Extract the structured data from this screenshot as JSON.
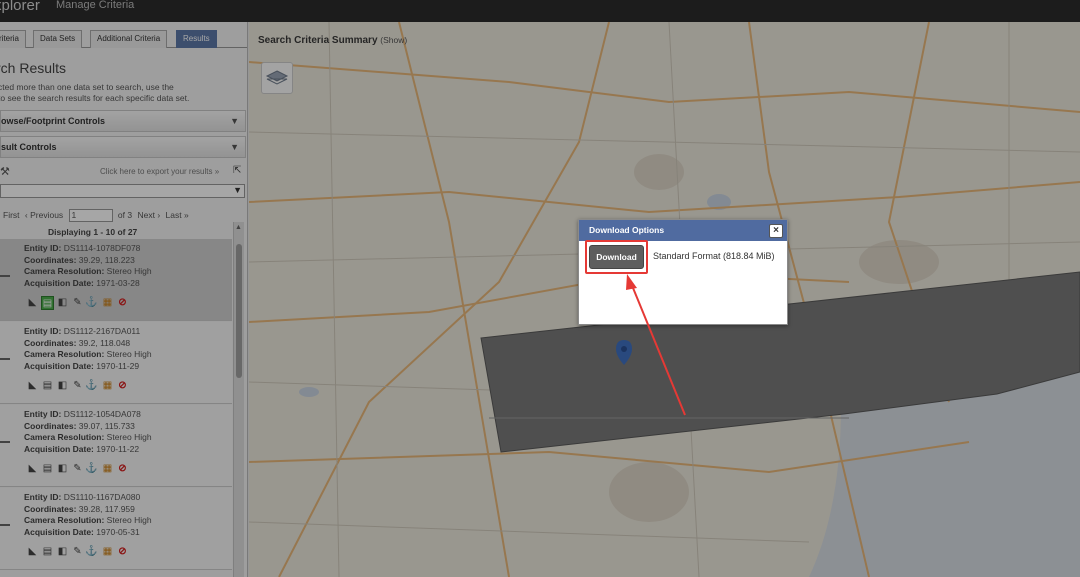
{
  "topbar": {
    "app_title": "xplorer",
    "manage_criteria": "Manage Criteria"
  },
  "tabs": [
    {
      "label": "riteria"
    },
    {
      "label": "Data Sets"
    },
    {
      "label": "Additional Criteria"
    },
    {
      "label": "Results",
      "active": true
    }
  ],
  "results_panel": {
    "title": "rch Results",
    "description_lines": [
      "cted more than one data set to search, use the",
      " to see the search results for each specific data set."
    ],
    "accordion_browse": "owse/Footprint Controls",
    "accordion_result": "sult Controls",
    "export_text": "Click here to export your results »",
    "pager": {
      "first": "First",
      "previous": "‹ Previous",
      "page_value": "1",
      "of_text": "of 3",
      "next": "Next ›",
      "last": "Last »"
    },
    "displaying": "Displaying 1 - 10 of 27",
    "labels": {
      "entity": "Entity ID:",
      "coords": "Coordinates:",
      "camera": "Camera Resolution:",
      "date": "Acquisition Date:"
    },
    "results": [
      {
        "entity_id": "DS1114-1078DF078",
        "coordinates": "39.29, 118.223",
        "camera": "Stereo High",
        "date": "1971-03-28",
        "selected": true
      },
      {
        "entity_id": "DS1112-2167DA011",
        "coordinates": "39.2, 118.048",
        "camera": "Stereo High",
        "date": "1970-11-29",
        "selected": false
      },
      {
        "entity_id": "DS1112-1054DA078",
        "coordinates": "39.07, 115.733",
        "camera": "Stereo High",
        "date": "1970-11-22",
        "selected": false
      },
      {
        "entity_id": "DS1110-1167DA080",
        "coordinates": "39.28, 117.959",
        "camera": "Stereo High",
        "date": "1970-05-31",
        "selected": false
      }
    ]
  },
  "map": {
    "title": "Search Criteria Summary",
    "show_label": "(Show)"
  },
  "dialog": {
    "title": "Download Options",
    "close_label": "×",
    "download_label": "Download",
    "format_label": "Standard Format (818.84 MiB)"
  },
  "colors": {
    "accent": "#506ba0",
    "highlight": "#e53935",
    "topbar": "#2b2b2b"
  }
}
